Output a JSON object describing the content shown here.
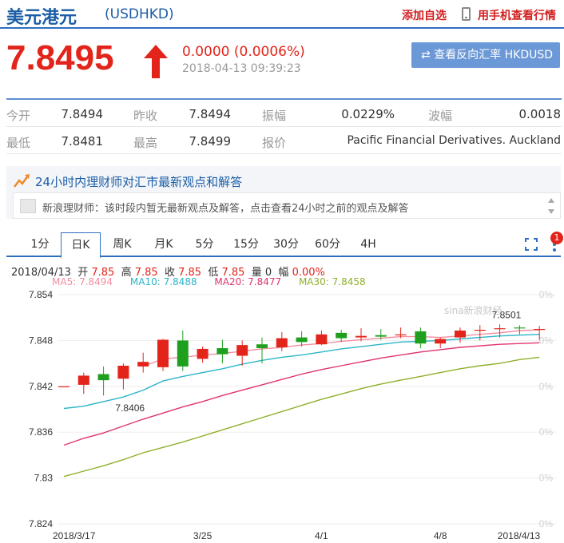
{
  "header": {
    "title": "美元港元",
    "code": "(USDHKD)",
    "add_watch": "添加自选",
    "mobile_view": "用手机查看行情"
  },
  "quote": {
    "price": "7.8495",
    "change": "0.0000 (0.0006%)",
    "timestamp": "2018-04-13 09:39:23",
    "reverse_button": "查看反向汇率 HKDUSD",
    "up_color": "#e3241a"
  },
  "stats": [
    {
      "label1": "今开",
      "value1": "7.8494",
      "label2": "昨收",
      "value2": "7.8494",
      "label3": "振幅",
      "value3": "0.0229%",
      "label4": "波幅",
      "value4": "0.0018"
    },
    {
      "label1": "最低",
      "value1": "7.8481",
      "label2": "最高",
      "value2": "7.8499",
      "label3": "报价",
      "value3": "Pacific Financial Derivatives. Auckland"
    }
  ],
  "advice": {
    "title": "24小时内理财师对汇市最新观点和解答",
    "message": "新浪理财师：该时段内暂无最新观点及解答，点击查看24小时之前的观点及解答"
  },
  "tabs": [
    "1分",
    "日K",
    "周K",
    "月K",
    "5分",
    "15分",
    "30分",
    "60分",
    "4H"
  ],
  "active_tab": "日K",
  "badge_count": "1",
  "candle_info": {
    "date": "2018/04/13",
    "open_label": "开",
    "open": "7.85",
    "high_label": "高",
    "high": "7.85",
    "close_label": "收",
    "close": "7.85",
    "low_label": "低",
    "low": "7.85",
    "volume_label": "量",
    "volume": "0",
    "range_label": "幅",
    "range": "0.00%"
  },
  "ma_legend": [
    {
      "name": "MA5",
      "value": "7.8494",
      "color": "#f28ea0"
    },
    {
      "name": "MA10",
      "value": "7.8488",
      "color": "#2bb5c8"
    },
    {
      "name": "MA20",
      "value": "7.8477",
      "color": "#e0336e"
    },
    {
      "name": "MA30",
      "value": "7.8458",
      "color": "#8fb02a"
    }
  ],
  "chart_data": {
    "type": "candlestick",
    "watermark": "sina新浪财经",
    "y_ticks": [
      "7.854",
      "7.848",
      "7.842",
      "7.836",
      "7.83",
      "7.824"
    ],
    "y_right_ticks": [
      "0%",
      "0%",
      "0%",
      "0%",
      "0%",
      "0%"
    ],
    "ylim": [
      7.824,
      7.854
    ],
    "x_ticks": [
      {
        "label": "2018/3/17",
        "index": 0
      },
      {
        "label": "3/25",
        "index": 7
      },
      {
        "label": "4/1",
        "index": 13
      },
      {
        "label": "4/8",
        "index": 19
      },
      {
        "label": "2018/4/13",
        "index": 24
      }
    ],
    "annotations": [
      {
        "text": "7.8406",
        "index": 3,
        "value": 7.8406
      },
      {
        "text": "7.8501",
        "index": 22,
        "value": 7.8501
      }
    ],
    "up_color": "#e3241a",
    "down_color": "#1ea01e",
    "candles": [
      {
        "o": 7.842,
        "h": 7.842,
        "l": 7.842,
        "c": 7.842
      },
      {
        "o": 7.8422,
        "h": 7.8438,
        "l": 7.841,
        "c": 7.8434
      },
      {
        "o": 7.8436,
        "h": 7.8446,
        "l": 7.8408,
        "c": 7.8428
      },
      {
        "o": 7.843,
        "h": 7.845,
        "l": 7.8416,
        "c": 7.8447
      },
      {
        "o": 7.8446,
        "h": 7.8464,
        "l": 7.8438,
        "c": 7.8452
      },
      {
        "o": 7.8445,
        "h": 7.8482,
        "l": 7.844,
        "c": 7.8481
      },
      {
        "o": 7.848,
        "h": 7.8493,
        "l": 7.844,
        "c": 7.8446
      },
      {
        "o": 7.8456,
        "h": 7.8472,
        "l": 7.8451,
        "c": 7.8469
      },
      {
        "o": 7.847,
        "h": 7.8481,
        "l": 7.845,
        "c": 7.8462
      },
      {
        "o": 7.846,
        "h": 7.848,
        "l": 7.8447,
        "c": 7.8474
      },
      {
        "o": 7.8475,
        "h": 7.8484,
        "l": 7.845,
        "c": 7.847
      },
      {
        "o": 7.8471,
        "h": 7.8491,
        "l": 7.8466,
        "c": 7.8483
      },
      {
        "o": 7.8484,
        "h": 7.8492,
        "l": 7.8472,
        "c": 7.8478
      },
      {
        "o": 7.8475,
        "h": 7.8493,
        "l": 7.8474,
        "c": 7.8488
      },
      {
        "o": 7.849,
        "h": 7.8494,
        "l": 7.8478,
        "c": 7.8483
      },
      {
        "o": 7.8484,
        "h": 7.8496,
        "l": 7.8479,
        "c": 7.8486
      },
      {
        "o": 7.8487,
        "h": 7.8495,
        "l": 7.8481,
        "c": 7.8485
      },
      {
        "o": 7.8487,
        "h": 7.8497,
        "l": 7.8483,
        "c": 7.8488
      },
      {
        "o": 7.8492,
        "h": 7.8497,
        "l": 7.847,
        "c": 7.8476
      },
      {
        "o": 7.8476,
        "h": 7.8484,
        "l": 7.847,
        "c": 7.8482
      },
      {
        "o": 7.8484,
        "h": 7.8497,
        "l": 7.8477,
        "c": 7.8493
      },
      {
        "o": 7.8494,
        "h": 7.85,
        "l": 7.848,
        "c": 7.8494
      },
      {
        "o": 7.8495,
        "h": 7.8501,
        "l": 7.8484,
        "c": 7.8496
      },
      {
        "o": 7.8497,
        "h": 7.85,
        "l": 7.8488,
        "c": 7.8496
      },
      {
        "o": 7.8495,
        "h": 7.8499,
        "l": 7.8481,
        "c": 7.8495
      }
    ],
    "series": [
      {
        "name": "MA5",
        "color": "#f28ea0",
        "values": [
          null,
          null,
          null,
          null,
          7.8446,
          7.8456,
          7.8458,
          7.8461,
          7.8463,
          7.8466,
          7.8469,
          7.8471,
          7.8474,
          7.8476,
          7.8479,
          7.8481,
          7.8483,
          7.8485,
          7.8485,
          7.8484,
          7.8486,
          7.8488,
          7.849,
          7.8493,
          7.8494
        ]
      },
      {
        "name": "MA10",
        "color": "#2bb5c8",
        "values": [
          7.8391,
          7.8394,
          7.84,
          7.8406,
          7.8415,
          7.8427,
          7.8433,
          7.8438,
          7.8443,
          7.8449,
          7.8454,
          7.8458,
          7.8461,
          7.8465,
          7.8469,
          7.8472,
          7.8475,
          7.8478,
          7.8479,
          7.848,
          7.8482,
          7.8484,
          7.8486,
          7.8487,
          7.8488
        ]
      },
      {
        "name": "MA20",
        "color": "#e0336e",
        "values": [
          7.8343,
          7.8352,
          7.8359,
          7.8368,
          7.8377,
          7.8385,
          7.8393,
          7.84,
          7.8408,
          7.8415,
          7.8422,
          7.8429,
          7.8436,
          7.8442,
          7.8447,
          7.8452,
          7.8457,
          7.8461,
          7.8465,
          7.8468,
          7.8471,
          7.8473,
          7.8475,
          7.8476,
          7.8477
        ]
      },
      {
        "name": "MA30",
        "color": "#8fb02a",
        "values": [
          7.8302,
          7.8309,
          7.8316,
          7.8324,
          7.8333,
          7.834,
          7.8347,
          7.8355,
          7.8363,
          7.8371,
          7.8379,
          7.8387,
          7.8395,
          7.8403,
          7.841,
          7.8417,
          7.8423,
          7.8428,
          7.8433,
          7.8438,
          7.8443,
          7.8447,
          7.845,
          7.8455,
          7.8458
        ]
      }
    ]
  }
}
